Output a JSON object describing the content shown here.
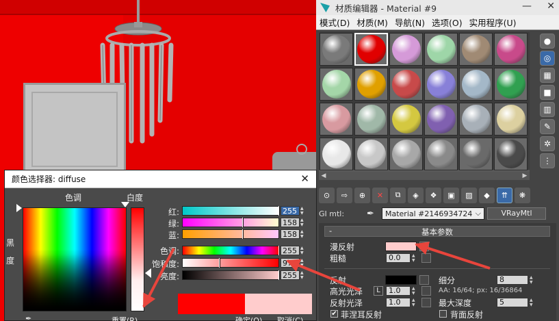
{
  "colors": {
    "viewport_red": "#ee0000",
    "diffuse_color": "#ffcccc",
    "original_color": "#ff0000",
    "annotation_arrow": "#e8453c"
  },
  "material_editor": {
    "title": "材质编辑器 - Material #9",
    "window_buttons": [
      "—",
      "✕"
    ],
    "menu": [
      "模式(D)",
      "材质(M)",
      "导航(N)",
      "选项(O)",
      "实用程序(U)"
    ],
    "slot_colors": [
      "#7a7a7a",
      "#e00000",
      "#d59ad8",
      "#9ed6a8",
      "#a08a74",
      "#c84a8a",
      "#a4d6a8",
      "#e0a000",
      "#c84a4a",
      "#8880d8",
      "#a4b8c8",
      "#30a050",
      "#d89aa0",
      "#a0b8a8",
      "#d4c840",
      "#8060b0",
      "#a8b0b8",
      "#dcd0a0",
      "#e8e8e8",
      "#c8c8c8",
      "#a8a8a8",
      "#8a8a8a",
      "#6a6a6a",
      "#4a4a4a"
    ],
    "side_tools": [
      "sphere-icon",
      "magnify-icon",
      "checker-icon",
      "box-icon",
      "colorbars-icon",
      "eraser-icon",
      "nodes-icon",
      "tree-icon"
    ],
    "gi_label": "GI mtl:",
    "material_name": "Material #2146934724",
    "material_type": "VRayMtl",
    "rollout_title": "基本参数",
    "rollout_toggle": "-",
    "params": {
      "diffuse_label": "漫反射",
      "roughness_label": "粗糙",
      "roughness_value": "0.0",
      "reflect_label": "反射",
      "highlight_label": "高光光泽",
      "highlight_value": "1.0",
      "lock_label": "L",
      "refl_gloss_label": "反射光泽",
      "refl_gloss_value": "1.0",
      "fresnel_label": "菲涅耳反射",
      "fresnel_check": "✔",
      "subdivs_label": "细分",
      "subdivs_value": "8",
      "aa_info": "AA: 16/64; px: 16/36864",
      "max_depth_label": "最大深度",
      "max_depth_value": "5",
      "back_reflect_label": "背面反射"
    }
  },
  "color_picker": {
    "title": "颜色选择器: diffuse",
    "close": "✕",
    "hue_label": "色调",
    "whiteness_label": "白度",
    "black_label_1": "黑",
    "black_label_2": "度",
    "rows": [
      {
        "label": "红:",
        "value": "255"
      },
      {
        "label": "绿:",
        "value": "158"
      },
      {
        "label": "蓝:",
        "value": "158"
      },
      {
        "label": "色调:",
        "value": "255"
      },
      {
        "label": "饱和度:",
        "value": "97"
      },
      {
        "label": "亮度:",
        "value": "255"
      }
    ],
    "reset_label": "重置(R)",
    "ok_label": "确定(O)",
    "cancel_label": "取消(C)"
  }
}
